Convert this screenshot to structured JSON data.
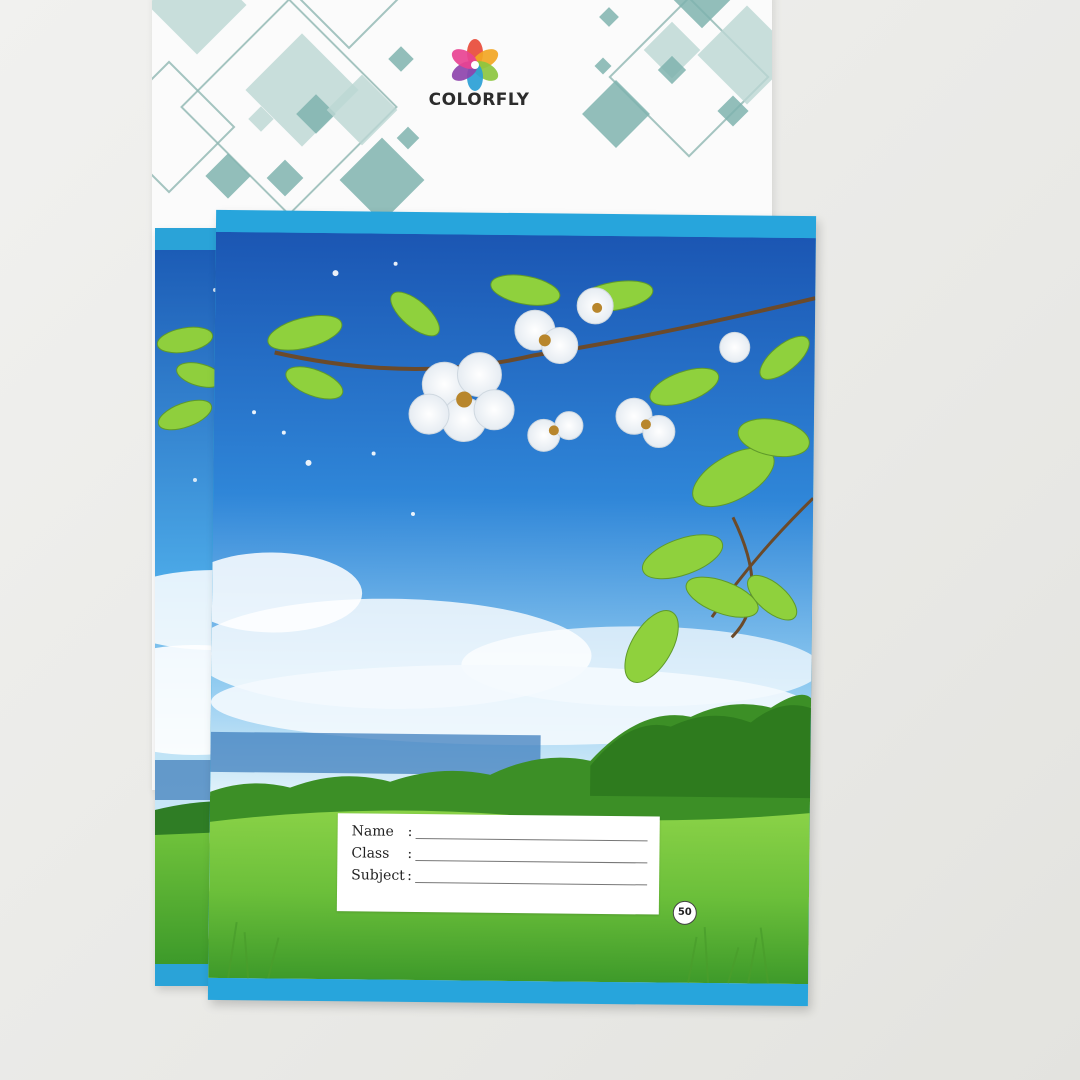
{
  "brand": {
    "name": "COLORFLY",
    "petal_colors": [
      "#e84b3a",
      "#f2a623",
      "#8cc63f",
      "#2a9fd6",
      "#8e44ad",
      "#e84393"
    ]
  },
  "label": {
    "name": "Name",
    "class": "Class",
    "subject": "Subject",
    "colon": ":"
  },
  "badge": "50",
  "colors": {
    "cover_blue": "#27a5dc",
    "sky_top": "#1e5fb8",
    "sky_bottom": "#bfe3f6",
    "grass": "#6bbf3a",
    "pattern_teal": "#7fb3ae"
  }
}
